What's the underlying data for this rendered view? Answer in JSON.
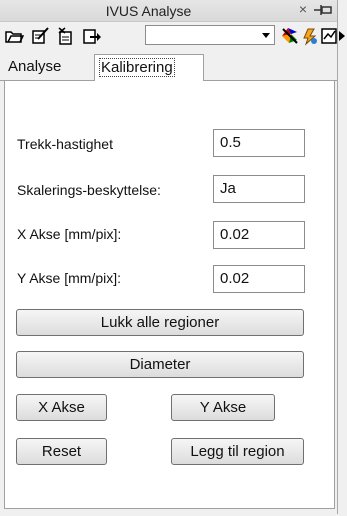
{
  "window": {
    "title": "IVUS Analyse",
    "close_glyph": "×"
  },
  "toolbar": {
    "icons": [
      "open-folder-icon",
      "edit-doc-icon",
      "tools-doc-icon",
      "export-icon",
      "color-wheel-icon",
      "pointer-icon",
      "graph-icon",
      "arrow-right-icon"
    ],
    "combo_value": ""
  },
  "tabs": [
    {
      "label": "Analyse",
      "active": false
    },
    {
      "label": "Kalibrering",
      "active": true
    }
  ],
  "form": {
    "trekk": {
      "label": "Trekk-hastighet",
      "value": "0.5"
    },
    "skalering": {
      "label": "Skalerings-beskyttelse:",
      "value": "Ja"
    },
    "xakse": {
      "label": "X Akse [mm/pix]:",
      "value": "0.02"
    },
    "yakse": {
      "label": "Y Akse [mm/pix]:",
      "value": "0.02"
    }
  },
  "buttons": {
    "lukk": "Lukk alle regioner",
    "diameter": "Diameter",
    "xakse": "X Akse",
    "yakse": "Y Akse",
    "reset": "Reset",
    "legg": "Legg til region"
  }
}
